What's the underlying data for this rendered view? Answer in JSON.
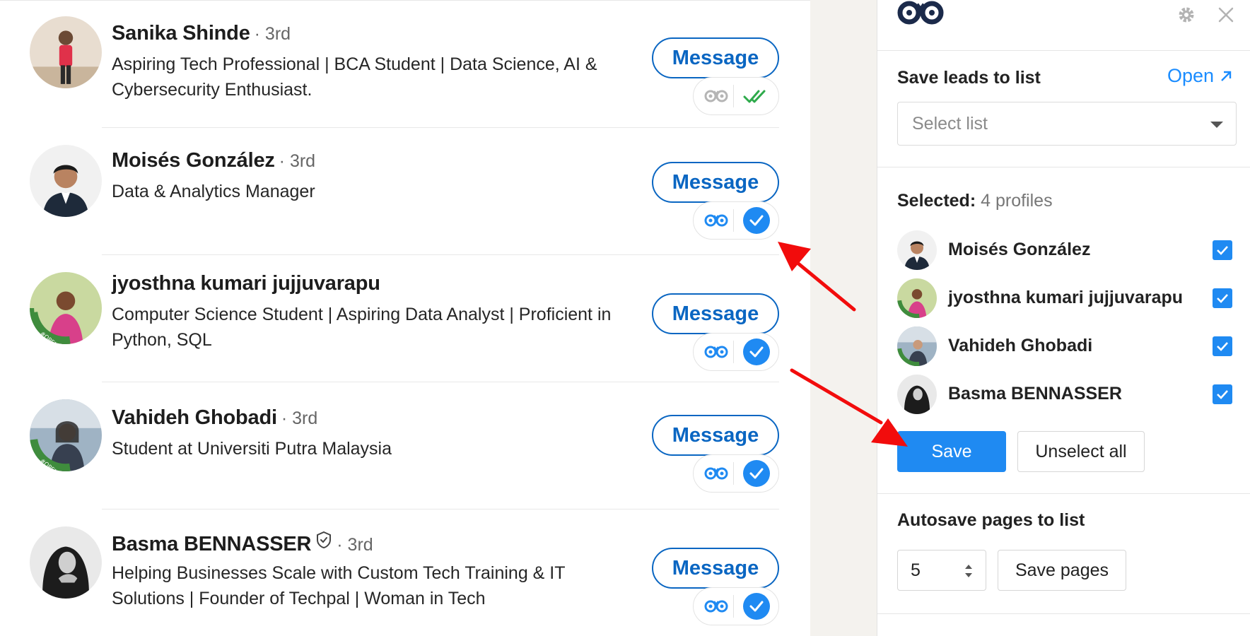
{
  "colors": {
    "linkedin_blue": "#0a66c2",
    "extension_blue": "#1f8af2",
    "link_blue": "#1a8cff",
    "arrow_red": "#f20c0c",
    "gutter_bg": "#f4f2ee",
    "check_green": "#2eaa4b"
  },
  "people": [
    {
      "name": "Sanika Shinde",
      "degree": "· 3rd",
      "headline": "Aspiring Tech Professional | BCA Student | Data Science, AI & Cybersecurity Enthusiast.",
      "message_label": "Message",
      "status_icon": "double-check-icon",
      "verified": false
    },
    {
      "name": "Moisés González",
      "degree": "· 3rd",
      "headline": "Data & Analytics Manager",
      "message_label": "Message",
      "status_icon": "check-circle-icon",
      "verified": false
    },
    {
      "name": "jyosthna kumari jujjuvarapu",
      "degree": "",
      "headline": "Computer Science Student | Aspiring Data Analyst | Proficient in Python, SQL",
      "message_label": "Message",
      "status_icon": "check-circle-icon",
      "verified": false
    },
    {
      "name": "Vahideh Ghobadi",
      "degree": "· 3rd",
      "headline": "Student at Universiti Putra Malaysia",
      "message_label": "Message",
      "status_icon": "check-circle-icon",
      "verified": false
    },
    {
      "name": "Basma BENNASSER",
      "degree": "· 3rd",
      "headline": "Helping Businesses Scale with Custom Tech Training & IT Solutions | Founder of Techpal | Woman in Tech",
      "message_label": "Message",
      "status_icon": "check-circle-icon",
      "verified": true
    }
  ],
  "panel": {
    "save_leads_title": "Save leads to list",
    "open_label": "Open",
    "select_placeholder": "Select list",
    "selected_label": "Selected:",
    "selected_count": "4 profiles",
    "selected_profiles": [
      {
        "name": "Moisés González",
        "checked": true
      },
      {
        "name": "jyosthna kumari jujjuvarapu",
        "checked": true
      },
      {
        "name": "Vahideh Ghobadi",
        "checked": true
      },
      {
        "name": "Basma BENNASSER",
        "checked": true
      }
    ],
    "save_label": "Save",
    "unselect_label": "Unselect all",
    "autosave_title": "Autosave pages to list",
    "pages_value": "5",
    "save_pages_label": "Save pages"
  }
}
